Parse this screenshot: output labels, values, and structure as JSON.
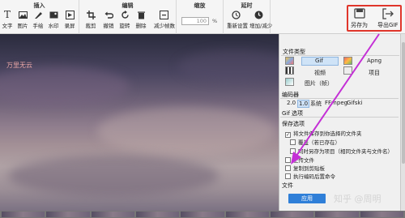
{
  "ribbon": {
    "insert": {
      "title": "插入",
      "tools": [
        "文字",
        "图片",
        "手绘",
        "水印",
        "录屏"
      ]
    },
    "edit": {
      "title": "编辑",
      "tools": [
        "裁剪",
        "撤销",
        "旋转",
        "删除",
        "减少帧数"
      ]
    },
    "zoom": {
      "title": "缩放",
      "value": "100",
      "unit": "%"
    },
    "delay": {
      "title": "延时",
      "tools": [
        "重新设置",
        "增加/减少"
      ]
    },
    "save_as": "另存为",
    "export_gif": "导出GIF"
  },
  "canvas": {
    "overlay_text": "万里无云"
  },
  "panel": {
    "file_type_label": "文件类型",
    "types": {
      "gif": "Gif",
      "apng": "Apng",
      "video": "视频",
      "project": "项目",
      "image": "图片（帧）"
    },
    "encoder_label": "编码器",
    "encoders": [
      "2.0",
      "1.0",
      "系统",
      "FFmpeg",
      "Gifski"
    ],
    "gif_options_label": "Gif 选项",
    "save_options_label": "保存选项",
    "options": [
      {
        "label": "将文件保存到你选择的文件夹",
        "checked": true
      },
      {
        "label": "覆盖（若已存在）",
        "checked": false
      },
      {
        "label": "同时另存为项目（相同文件夹与文件名）",
        "checked": false
      },
      {
        "label": "上传文件",
        "checked": false
      },
      {
        "label": "复制到剪贴板",
        "checked": false
      },
      {
        "label": "执行编码后置命令",
        "checked": false
      }
    ],
    "file_label": "文件",
    "apply_label": "应用"
  },
  "watermark": "知乎 @周明",
  "colors": {
    "accent": "#2f7fd8",
    "highlight": "#e0362b",
    "arrow": "#c42fd6"
  }
}
